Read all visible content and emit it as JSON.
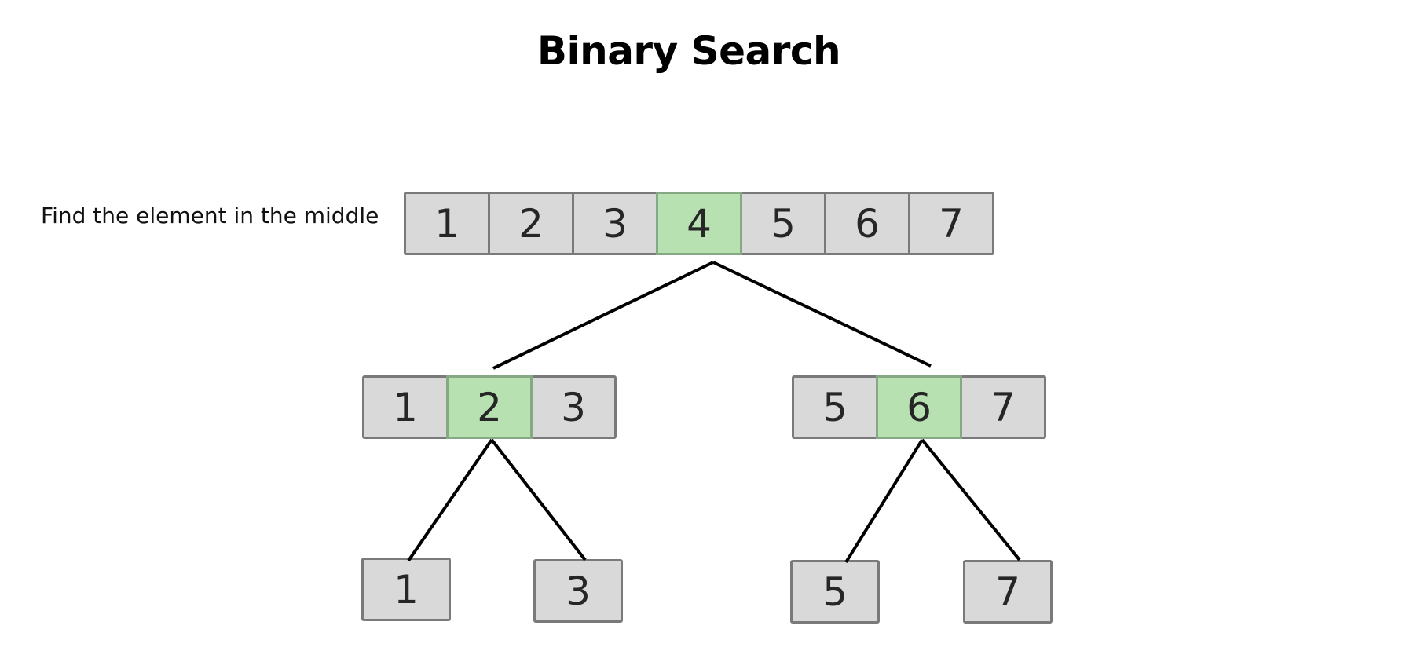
{
  "title": "Binary Search",
  "step_label": "Find the element in the middle",
  "colors": {
    "cell": "#d9d9d9",
    "highlight": "#b7e1b1",
    "border": "#7a7a7a",
    "edge": "#000000"
  },
  "levels": {
    "root": {
      "values": [
        "1",
        "2",
        "3",
        "4",
        "5",
        "6",
        "7"
      ],
      "middle_index": 3
    },
    "left": {
      "values": [
        "1",
        "2",
        "3"
      ],
      "middle_index": 1
    },
    "right": {
      "values": [
        "5",
        "6",
        "7"
      ],
      "middle_index": 1
    },
    "leaves": [
      "1",
      "3",
      "5",
      "7"
    ]
  },
  "edges": [
    {
      "from": "root-4",
      "to": "left-subarray"
    },
    {
      "from": "root-4",
      "to": "right-subarray"
    },
    {
      "from": "left-2",
      "to": "leaf-1"
    },
    {
      "from": "left-2",
      "to": "leaf-3"
    },
    {
      "from": "right-6",
      "to": "leaf-5"
    },
    {
      "from": "right-6",
      "to": "leaf-7"
    }
  ]
}
